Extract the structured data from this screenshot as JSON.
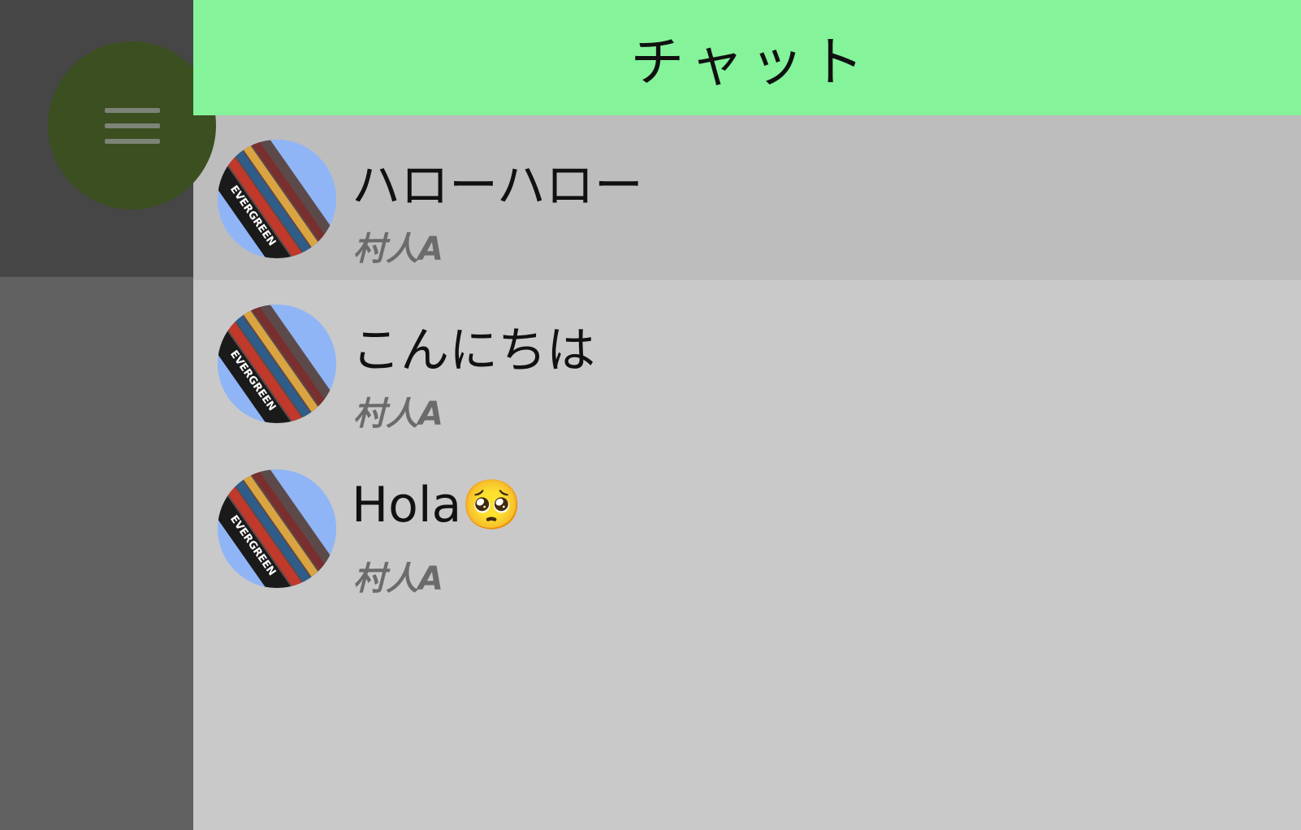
{
  "header": {
    "title": "チャット"
  },
  "menu_button": {
    "icon": "menu-icon"
  },
  "chats": [
    {
      "title": "ハローハロー",
      "sender": "村人A",
      "active": true
    },
    {
      "title": "こんにちは",
      "sender": "村人A",
      "active": false
    },
    {
      "title": "Hola🥺",
      "sender": "村人A",
      "active": false
    }
  ],
  "colors": {
    "header_bg": "#84f39a",
    "list_bg": "#c9c9c9",
    "active_row_bg": "#bdbdbd",
    "fab_bg": "#3b4f21",
    "avatar_bg": "#8fb5f6"
  }
}
